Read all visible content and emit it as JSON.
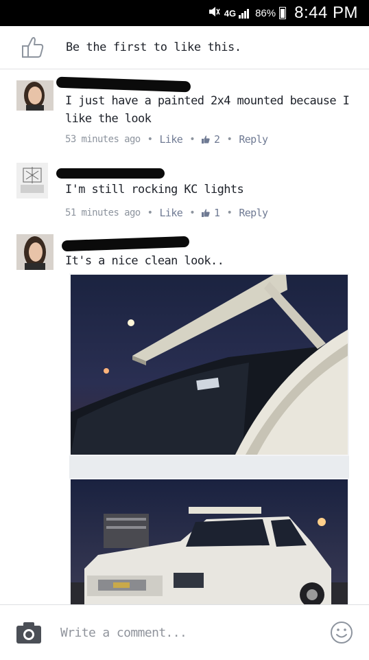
{
  "status_bar": {
    "network": "4G",
    "battery_percent": "86%",
    "time": "8:44 PM",
    "icons": [
      "mute-icon",
      "signal-icon",
      "battery-icon"
    ]
  },
  "like_bar": {
    "text": "Be the first to like this.",
    "icon": "thumbs-up-icon"
  },
  "comments": [
    {
      "text": "I just have a painted 2x4 mounted because I like the look",
      "time": "53 minutes ago",
      "like_label": "Like",
      "like_count": "2",
      "reply_label": "Reply"
    },
    {
      "text": "I'm still rocking KC lights",
      "time": "51 minutes ago",
      "like_label": "Like",
      "like_count": "1",
      "reply_label": "Reply"
    },
    {
      "text": "It's a nice clean look..",
      "has_photo": true
    }
  ],
  "composer": {
    "placeholder": "Write a comment...",
    "camera_icon": "camera-icon",
    "emoji_icon": "emoji-icon"
  },
  "colors": {
    "meta_text": "#8d949e",
    "action_text": "#6f7a93",
    "status_bar_bg": "#000000"
  }
}
